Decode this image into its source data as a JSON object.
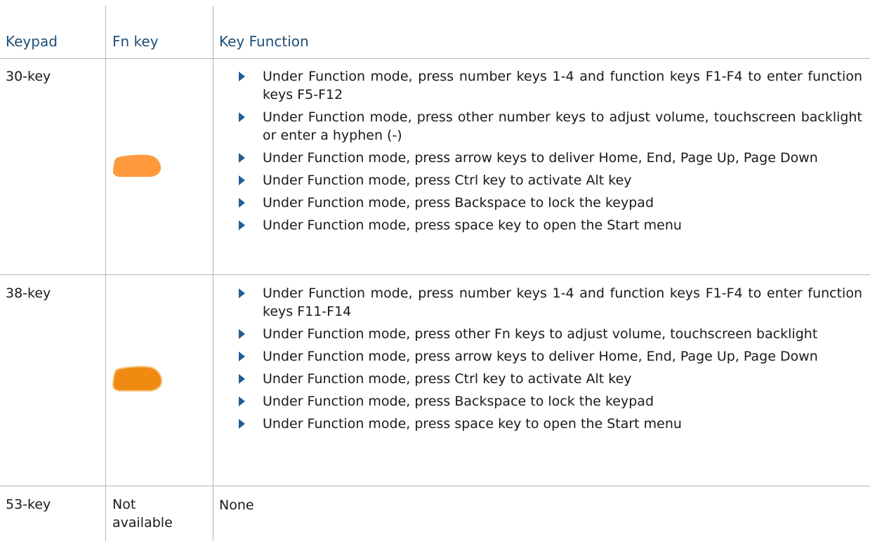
{
  "table": {
    "headers": {
      "keypad": "Keypad",
      "fn_key": "Fn key",
      "function": "Key Function"
    },
    "rows": [
      {
        "keypad": "30-key",
        "fn_key_icon": "orange-fn-key-icon",
        "functions": [
          "Under Function mode, press number keys 1-4 and function keys F1-F4 to enter function keys F5-F12",
          "Under Function mode, press other number keys to adjust volume, touchscreen backlight or enter a hyphen (-)",
          "Under Function mode, press arrow keys to deliver Home, End, Page Up, Page Down",
          "Under Function mode, press Ctrl key to activate Alt key",
          "Under Function mode, press Backspace to lock the keypad",
          "Under Function mode, press space key to open the Start menu"
        ]
      },
      {
        "keypad": "38-key",
        "fn_key_icon": "dark-orange-fn-key-icon",
        "functions": [
          "Under Function mode, press number keys 1-4 and function keys F1-F4 to enter function keys F11-F14",
          "Under Function mode, press other Fn keys to adjust volume, touchscreen backlight",
          "Under Function mode, press arrow keys to deliver Home, End, Page Up, Page Down",
          "Under Function mode, press Ctrl key to activate Alt key",
          "Under Function mode, press Backspace to lock the keypad",
          "Under Function mode, press space key to open the Start menu"
        ]
      },
      {
        "keypad": "53-key",
        "fn_key": "Not available",
        "function": "None"
      }
    ]
  },
  "colors": {
    "header_text": "#1f4e79",
    "bullet": "#1f5f96",
    "key_light": "#ff9a3c",
    "key_dark": "#f08a10",
    "rule": "#b3b3b3"
  }
}
